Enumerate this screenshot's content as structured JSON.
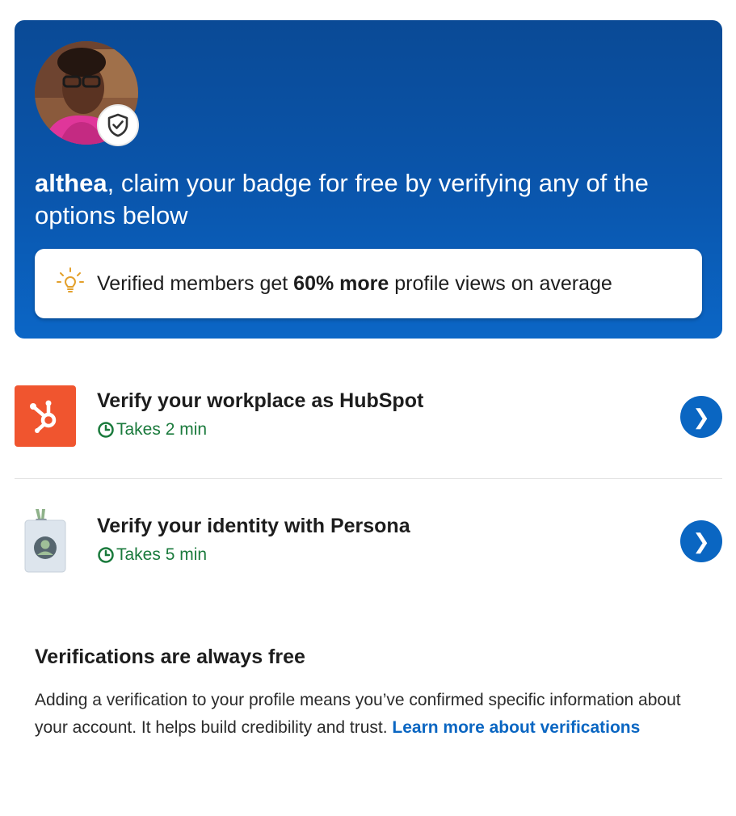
{
  "hero": {
    "name": "althea",
    "title_rest": ", claim your badge for free by verifying any of the options below",
    "stat": {
      "prefix": "Verified members get ",
      "highlight": "60% more",
      "suffix": " profile views on average"
    }
  },
  "options": [
    {
      "icon": "hubspot-logo-icon",
      "title": "Verify your workplace as HubSpot",
      "time": "Takes 2 min",
      "chevron": "❯"
    },
    {
      "icon": "id-badge-icon",
      "title": "Verify your identity with Persona",
      "time": "Takes 5 min",
      "chevron": "❯"
    }
  ],
  "info": {
    "heading": "Verifications are always free",
    "body": "Adding a verification to your profile means you’ve confirmed specific information about your account. It helps build credibility and trust. ",
    "link": "Learn more about verifications"
  },
  "colors": {
    "hero_blue": "#0a56ad",
    "accent_blue": "#0a66c2",
    "time_green": "#1a7a3c",
    "hubspot_orange": "#f0552f"
  }
}
